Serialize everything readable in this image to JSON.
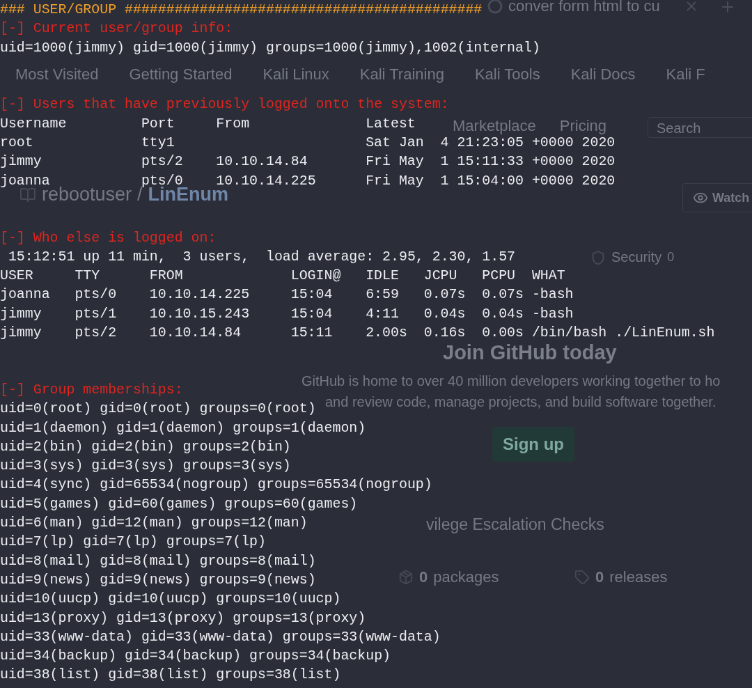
{
  "browser": {
    "tab_title": "conver form html to cu",
    "bookmarks": [
      "Most Visited",
      "Getting Started",
      "Kali Linux",
      "Kali Training",
      "Kali Tools",
      "Kali Docs",
      "Kali F"
    ],
    "nav": [
      "Marketplace",
      "Pricing"
    ],
    "search": {
      "placeholder": "Search"
    },
    "repo": {
      "owner": "rebootuser",
      "separator": "/",
      "name": "LinEnum"
    },
    "watch": "Watch",
    "security": {
      "label": "Security",
      "count": "0"
    },
    "join_title": "Join GitHub today",
    "join_text": [
      "GitHub is home to over 40 million developers working together to ho",
      "and review code, manage projects, and build software together."
    ],
    "signup": "Sign up",
    "description": "vilege Escalation Checks",
    "stats": [
      {
        "kind": "packages",
        "count": "0",
        "label": "packages"
      },
      {
        "kind": "releases",
        "count": "0",
        "label": "releases"
      }
    ]
  },
  "terminal": {
    "banner": "### USER/GROUP ###########################################",
    "sections": [
      {
        "heading": "[-] Current user/group info:",
        "lines": [
          "uid=1000(jimmy) gid=1000(jimmy) groups=1000(jimmy),1002(internal)"
        ]
      },
      {
        "heading": "[-] Users that have previously logged onto the system:",
        "table": {
          "kind": "lastlog",
          "columns": [
            "Username",
            "Port",
            "From",
            "Latest"
          ],
          "rows": [
            [
              "root",
              "tty1",
              "",
              "Sat Jan  4 21:23:05 +0000 2020"
            ],
            [
              "jimmy",
              "pts/2",
              "10.10.14.84",
              "Fri May  1 15:11:33 +0000 2020"
            ],
            [
              "joanna",
              "pts/0",
              "10.10.14.225",
              "Fri May  1 15:04:00 +0000 2020"
            ]
          ]
        }
      },
      {
        "heading": "[-] Who else is logged on:",
        "lines": [
          " 15:12:51 up 11 min,  3 users,  load average: 2.95, 2.30, 1.57"
        ],
        "table": {
          "kind": "w",
          "columns": [
            "USER",
            "TTY",
            "FROM",
            "LOGIN@",
            "IDLE",
            "JCPU",
            "PCPU",
            "WHAT"
          ],
          "rows": [
            [
              "joanna",
              "pts/0",
              "10.10.14.225",
              "15:04",
              "6:59",
              "0.07s",
              "0.07s",
              "-bash"
            ],
            [
              "jimmy",
              "pts/1",
              "10.10.15.243",
              "15:04",
              "4:11",
              "0.04s",
              "0.04s",
              "-bash"
            ],
            [
              "jimmy",
              "pts/2",
              "10.10.14.84",
              "15:11",
              "2.00s",
              "0.16s",
              "0.00s",
              "/bin/bash ./LinEnum.sh"
            ]
          ]
        }
      },
      {
        "heading": "[-] Group memberships:",
        "lines": [
          "uid=0(root) gid=0(root) groups=0(root)",
          "uid=1(daemon) gid=1(daemon) groups=1(daemon)",
          "uid=2(bin) gid=2(bin) groups=2(bin)",
          "uid=3(sys) gid=3(sys) groups=3(sys)",
          "uid=4(sync) gid=65534(nogroup) groups=65534(nogroup)",
          "uid=5(games) gid=60(games) groups=60(games)",
          "uid=6(man) gid=12(man) groups=12(man)",
          "uid=7(lp) gid=7(lp) groups=7(lp)",
          "uid=8(mail) gid=8(mail) groups=8(mail)",
          "uid=9(news) gid=9(news) groups=9(news)",
          "uid=10(uucp) gid=10(uucp) groups=10(uucp)",
          "uid=13(proxy) gid=13(proxy) groups=13(proxy)",
          "uid=33(www-data) gid=33(www-data) groups=33(www-data)",
          "uid=34(backup) gid=34(backup) groups=34(backup)",
          "uid=38(list) gid=38(list) groups=38(list)"
        ]
      }
    ]
  }
}
